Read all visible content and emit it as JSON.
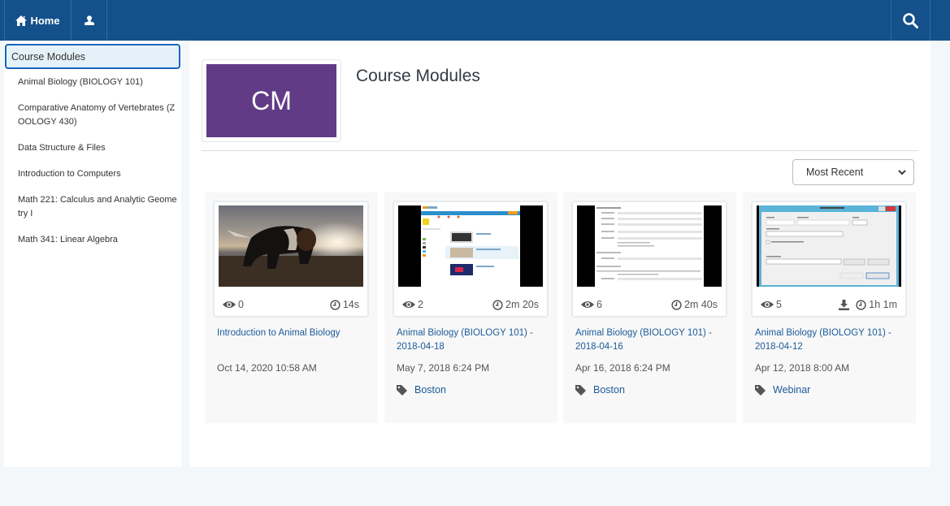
{
  "topbar": {
    "home_label": "Home",
    "home_icon": "home-icon",
    "user_icon": "user-icon",
    "search_icon": "search-icon",
    "background_color": "#14508a"
  },
  "sidebar": {
    "active_item": "Course Modules",
    "items": [
      {
        "label": "Animal Biology (BIOLOGY 101)"
      },
      {
        "label": "Comparative Anatomy of Vertebrates (ZOOLOGY 430)"
      },
      {
        "label": "Data Structure & Files"
      },
      {
        "label": "Introduction to Computers"
      },
      {
        "label": "Math 221: Calculus and Analytic Geometry I"
      },
      {
        "label": "Math 341: Linear Algebra"
      }
    ]
  },
  "header": {
    "logo_initials": "CM",
    "logo_color": "#623b86",
    "title": "Course Modules"
  },
  "sort": {
    "selected": "Most Recent"
  },
  "cards": [
    {
      "thumbnail": "puppy-on-beach",
      "views": "0",
      "duration": "14s",
      "downloadable": false,
      "title": "Introduction to Animal Biology",
      "date": "Oct 14, 2020 10:58 AM",
      "tag": null
    },
    {
      "thumbnail": "mediasite-portal-screenshot",
      "views": "2",
      "duration": "2m 20s",
      "downloadable": false,
      "title": "Animal Biology (BIOLOGY 101) - 2018-04-18",
      "date": "May 7, 2018 6:24 PM",
      "tag": "Boston"
    },
    {
      "thumbnail": "configuration-form-screenshot",
      "views": "6",
      "duration": "2m 40s",
      "downloadable": false,
      "title": "Animal Biology (BIOLOGY 101) - 2018-04-16",
      "date": "Apr 16, 2018 6:24 PM",
      "tag": "Boston"
    },
    {
      "thumbnail": "edit-site-binding-dialog",
      "views": "5",
      "duration": "1h 1m",
      "downloadable": true,
      "title": "Animal Biology (BIOLOGY 101) - 2018-04-12",
      "date": "Apr 12, 2018 8:00 AM",
      "tag": "Webinar"
    }
  ]
}
